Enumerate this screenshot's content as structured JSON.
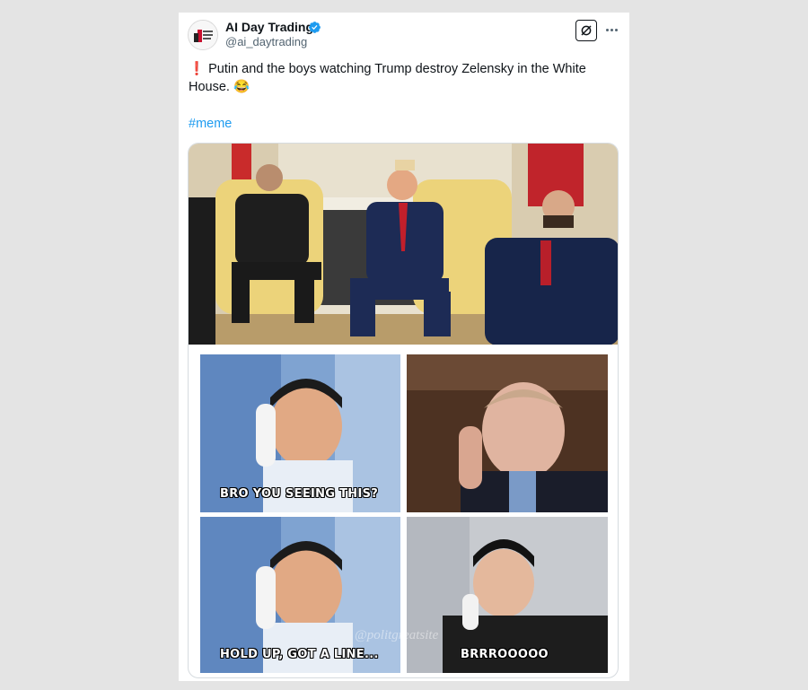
{
  "account": {
    "display_name": "AI Day Trading",
    "handle": "@ai_daytrading",
    "verified": true,
    "avatar_icon": "ai-day-trading-logo"
  },
  "tweet": {
    "alert_emoji": "❗",
    "text": "Putin and the boys watching Trump destroy Zelensky in the White House.",
    "laugh_emoji": "😂",
    "hashtag": "#meme"
  },
  "actions": {
    "grok_icon": "grok-icon",
    "more_icon": "more-icon"
  },
  "meme": {
    "captions": {
      "top_left": "BRO YOU SEEING THIS?",
      "bottom_left": "HOLD UP, GOT A LINE...",
      "bottom_right": "BRRROOOOO"
    },
    "watermark": "@politgreatsite"
  },
  "colors": {
    "link": "#1d9bf0",
    "verified": "#1d9bf0",
    "handle": "#536471",
    "page_bg": "#e4e4e4"
  }
}
